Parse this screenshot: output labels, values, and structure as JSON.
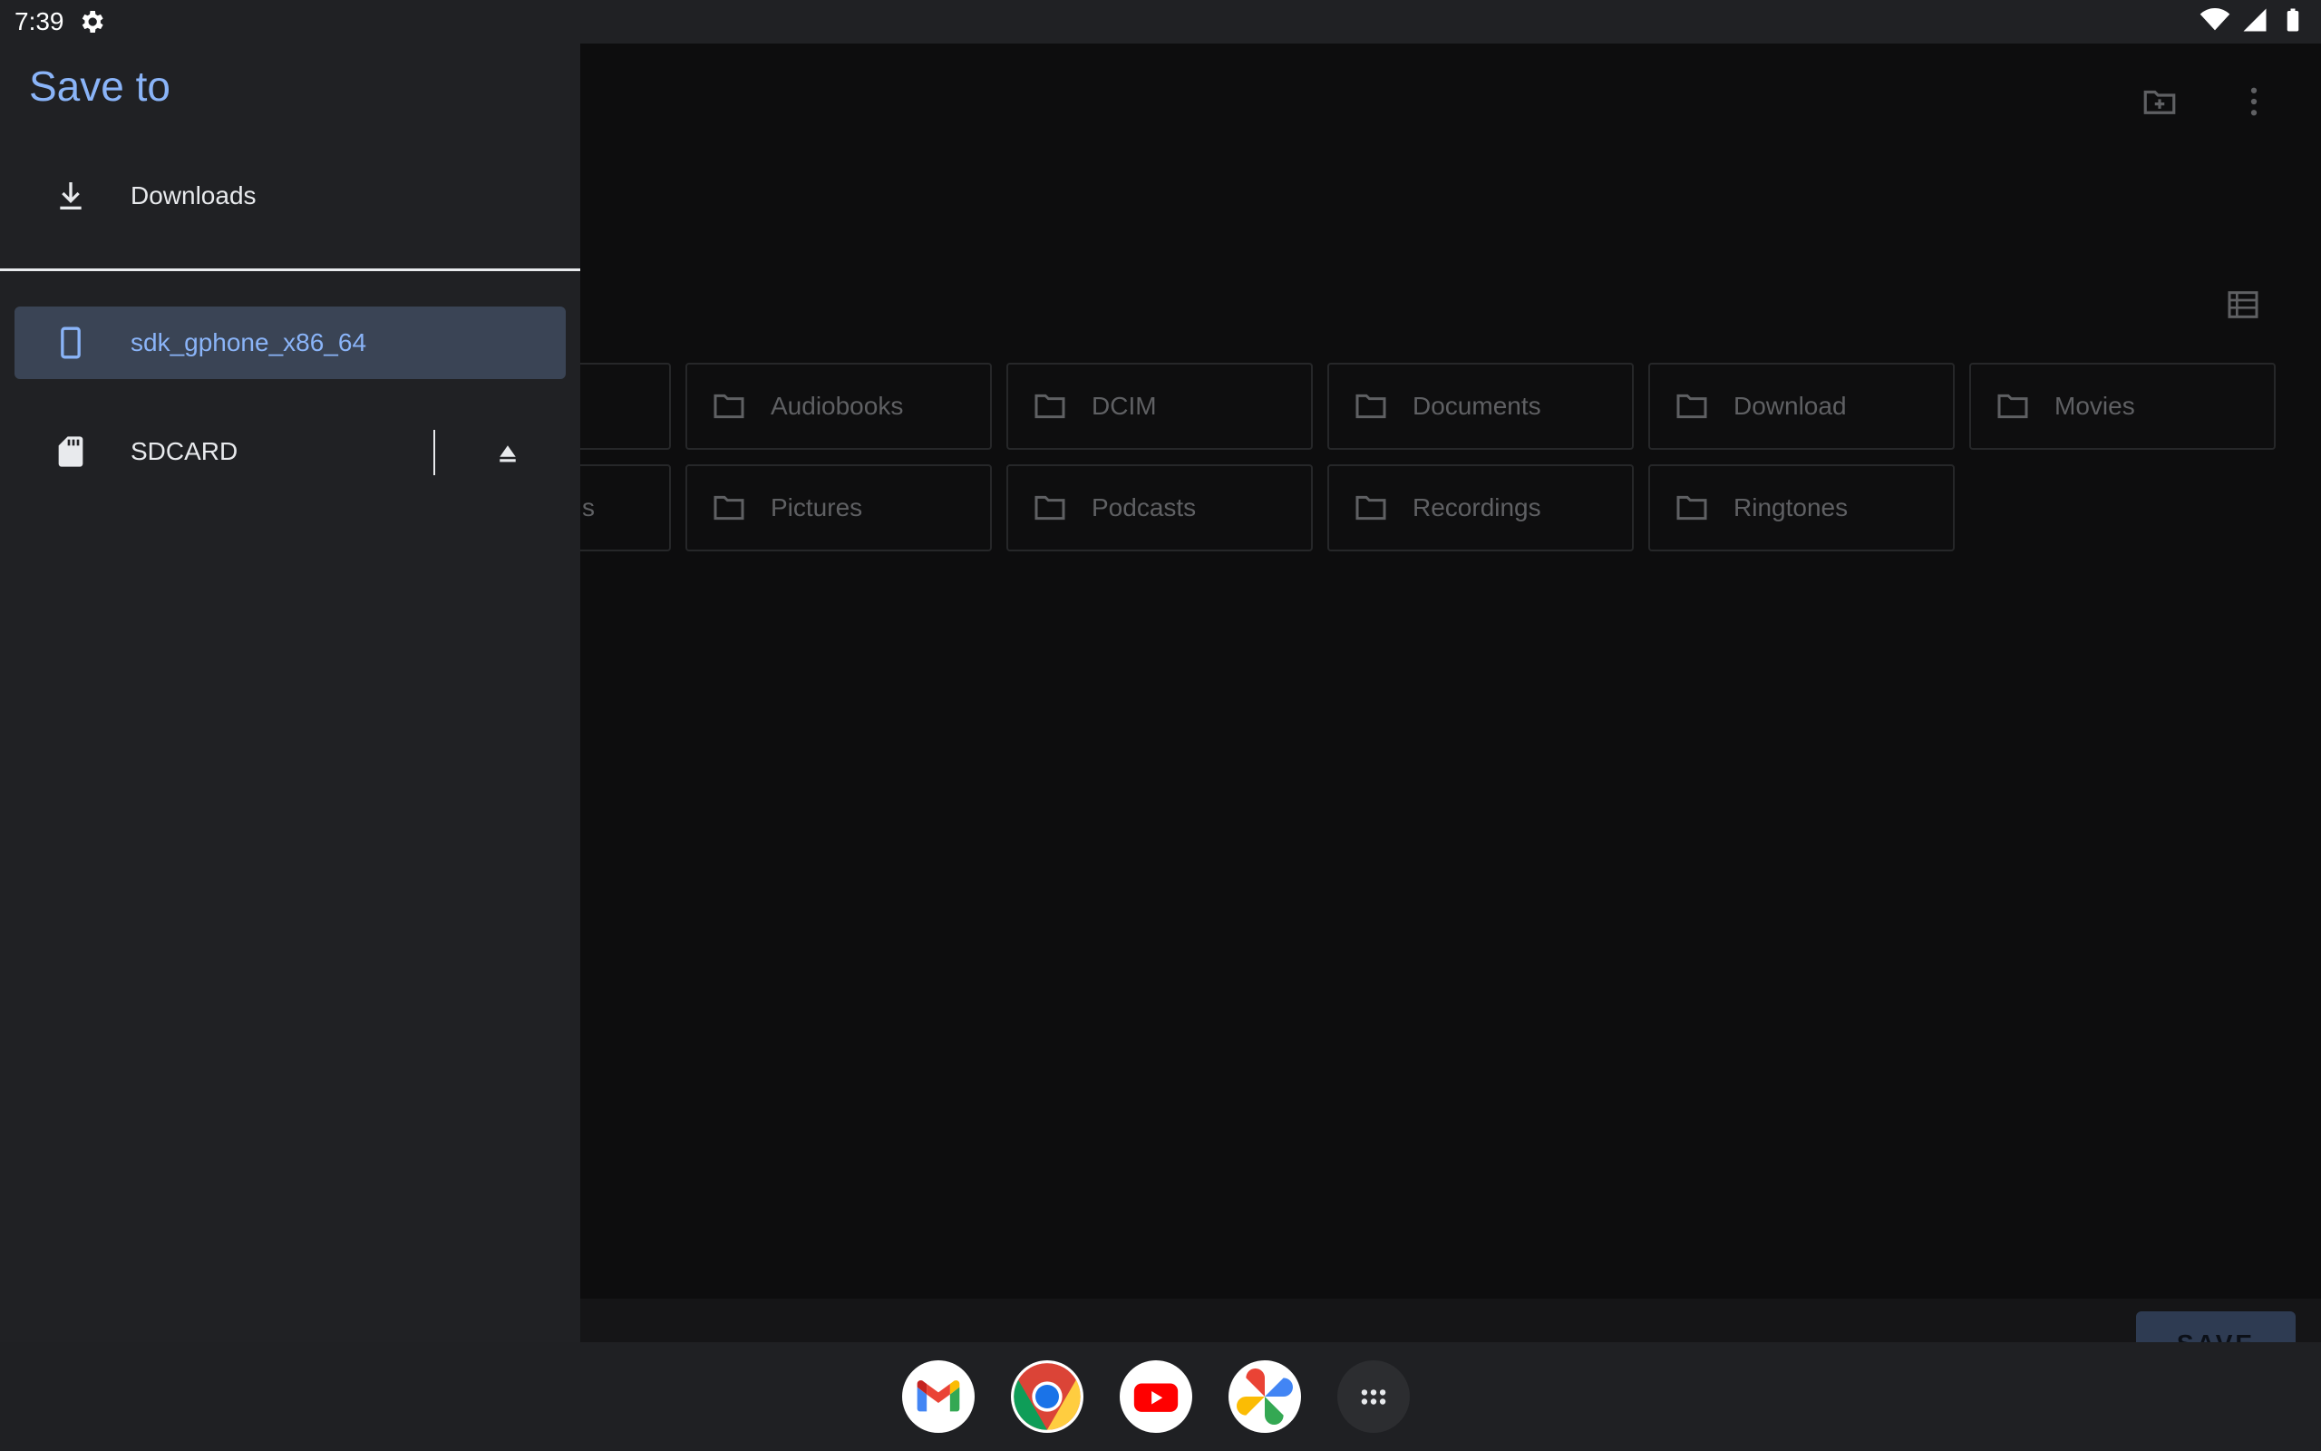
{
  "status_bar": {
    "time": "7:39",
    "icons": [
      "gear-icon",
      "wifi-icon",
      "signal-icon",
      "battery-icon"
    ]
  },
  "drawer": {
    "title": "Save to",
    "items": [
      {
        "label": "Downloads",
        "icon": "download-icon",
        "selected": false
      },
      {
        "label": "sdk_gphone_x86_64",
        "icon": "phone-icon",
        "selected": true
      },
      {
        "label": "SDCARD",
        "icon": "sd-card-icon",
        "selected": false
      }
    ]
  },
  "toolbar": {
    "actions": [
      "new-folder-icon",
      "more-vert-icon",
      "list-view-icon"
    ]
  },
  "folders": {
    "row1": [
      "Audiobooks",
      "DCIM",
      "Documents",
      "Download",
      "Movies"
    ],
    "row2": [
      "Pictures",
      "Podcasts",
      "Recordings",
      "Ringtones"
    ],
    "partial_row2_text": "s"
  },
  "bottom": {
    "save_label": "SAVE"
  },
  "taskbar": {
    "apps": [
      "gmail-icon",
      "chrome-icon",
      "youtube-icon",
      "photos-icon",
      "app-drawer-icon"
    ]
  },
  "colors": {
    "accent": "#8ab4f8",
    "drawer_bg": "#202124",
    "selected_bg": "#3a4455",
    "save_button_bg": "#2e3b52"
  }
}
